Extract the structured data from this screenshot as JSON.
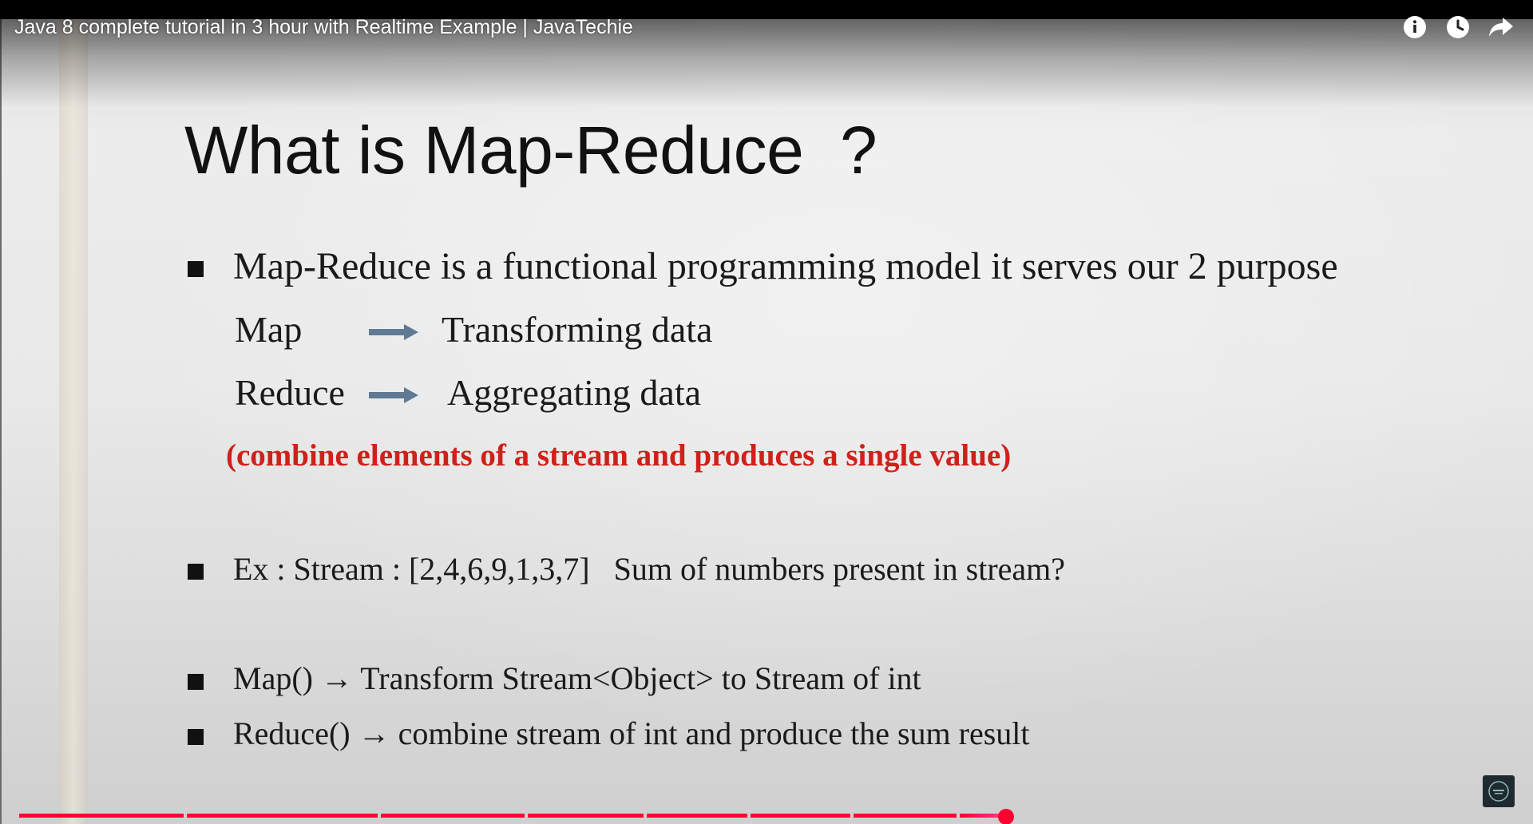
{
  "video": {
    "title": "Java 8 complete tutorial in 3 hour with Realtime Example | JavaTechie",
    "actions": [
      {
        "name": "info",
        "icon": "info-icon"
      },
      {
        "name": "watch-later",
        "icon": "clock-icon"
      },
      {
        "name": "share",
        "icon": "share-arrow-icon"
      }
    ],
    "progress_fraction": 0.66,
    "chapter_count": 9,
    "colors": {
      "progress_played": "#ff0033",
      "progress_buffered": "#ffffff",
      "progress_unplayed": "#d0d0d0"
    }
  },
  "slide": {
    "heading": "What is Map-Reduce  ?",
    "bullet1": "Map-Reduce is a functional programming model it serves our 2 purpose",
    "map_label": "Map",
    "map_desc": "Transforming data",
    "reduce_label": "Reduce",
    "reduce_desc": "Aggregating data",
    "note": "(combine elements of a stream and produces a single value)",
    "bullet2": "Ex : Stream : [2,4,6,9,1,3,7]   Sum of numbers present in stream?",
    "bullet3_prefix": "Map()",
    "bullet3_text": "Transform Stream<Object> to Stream of int",
    "bullet4_prefix": "Reduce()",
    "bullet4_text": "combine stream of int and produce the sum result",
    "arrow_glyph": "→",
    "colors": {
      "accent_red": "#d0201a",
      "arrow_blue": "#5f7a92"
    }
  }
}
